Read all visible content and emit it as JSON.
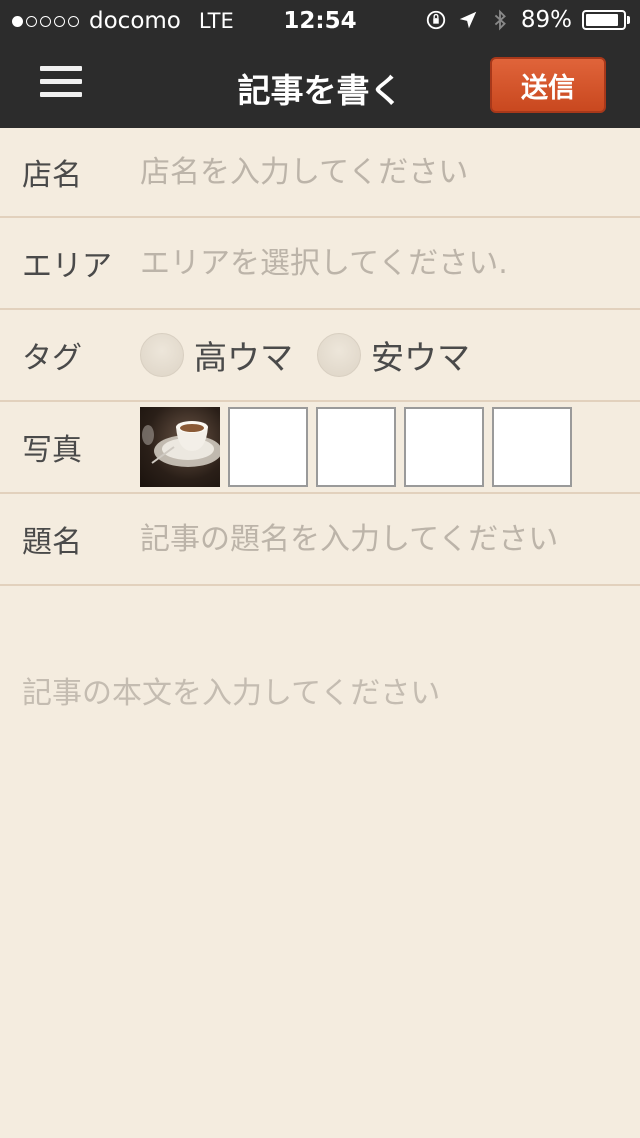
{
  "status_bar": {
    "carrier": "docomo",
    "network": "LTE",
    "time": "12:54",
    "battery": "89%",
    "battery_level": 0.89,
    "signal_bars_filled": 1,
    "signal_bars_total": 5
  },
  "nav": {
    "title": "記事を書く",
    "send_label": "送信"
  },
  "form": {
    "shop": {
      "label": "店名",
      "placeholder": "店名を入力してください"
    },
    "area": {
      "label": "エリア",
      "placeholder": "エリアを選択してください."
    },
    "tag": {
      "label": "タグ",
      "options": [
        "高ウマ",
        "安ウマ"
      ]
    },
    "photo": {
      "label": "写真",
      "slots_total": 5,
      "slots_filled": 1
    },
    "subject": {
      "label": "題名",
      "placeholder": "記事の題名を入力してください"
    },
    "body": {
      "placeholder": "記事の本文を入力してください"
    }
  },
  "colors": {
    "background": "#f4ecdf",
    "bar": "#2c2c2c",
    "accent": "#d4552a"
  }
}
